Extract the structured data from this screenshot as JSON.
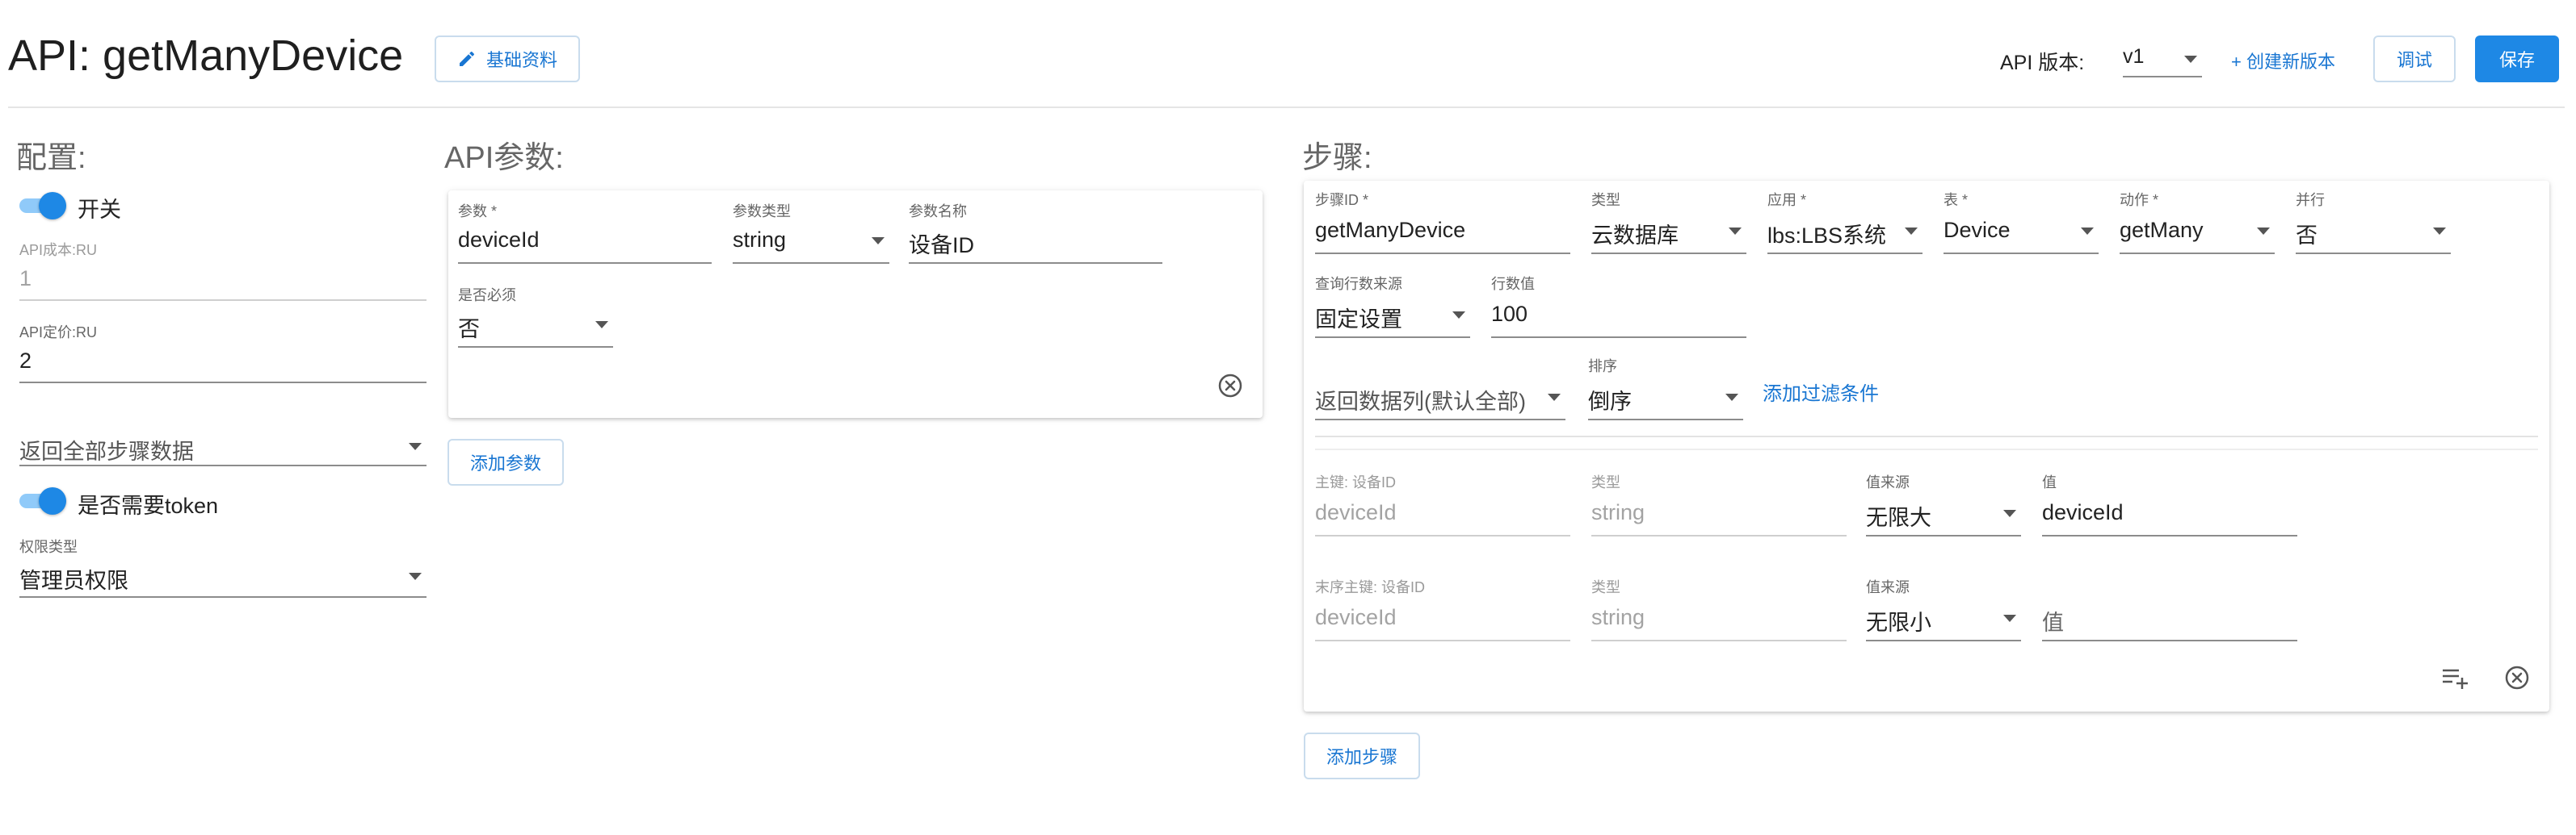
{
  "header": {
    "title": "API: getManyDevice",
    "basic_info_button": "基础资料",
    "version_label": "API 版本:",
    "version_value": "v1",
    "create_version_link": "+ 创建新版本",
    "debug_button": "调试",
    "save_button": "保存"
  },
  "config": {
    "title": "配置:",
    "switch_label": "开关",
    "switch_on": true,
    "cost_label": "API成本:RU",
    "cost_value": "1",
    "price_label": "API定价:RU",
    "price_value": "2",
    "return_select": "返回全部步骤数据",
    "token_label": "是否需要token",
    "token_on": true,
    "permission_label": "权限类型",
    "permission_value": "管理员权限"
  },
  "params": {
    "title": "API参数:",
    "items": [
      {
        "name_label": "参数 *",
        "name_value": "deviceId",
        "type_label": "参数类型",
        "type_value": "string",
        "display_label": "参数名称",
        "display_value": "设备ID",
        "required_label": "是否必须",
        "required_value": "否"
      }
    ],
    "add_button": "添加参数"
  },
  "steps": {
    "title": "步骤:",
    "items": [
      {
        "id_label": "步骤ID *",
        "id_value": "getManyDevice",
        "type_label": "类型",
        "type_value": "云数据库",
        "app_label": "应用 *",
        "app_value": "lbs:LBS系统",
        "table_label": "表 *",
        "table_value": "Device",
        "action_label": "动作 *",
        "action_value": "getMany",
        "parallel_label": "并行",
        "parallel_value": "否",
        "row_source_label": "查询行数来源",
        "row_source_value": "固定设置",
        "row_count_label": "行数值",
        "row_count_value": "100",
        "return_columns_value": "返回数据列(默认全部)",
        "sort_label": "排序",
        "sort_value": "倒序",
        "add_filter_link": "添加过滤条件",
        "keys": [
          {
            "key_label": "主键: 设备ID",
            "key_value": "deviceId",
            "type_label": "类型",
            "type_value": "string",
            "source_label": "值来源",
            "source_value": "无限大",
            "value_label": "值",
            "value_value": "deviceId",
            "value_is_placeholder": false
          },
          {
            "key_label": "末序主键: 设备ID",
            "key_value": "deviceId",
            "type_label": "类型",
            "type_value": "string",
            "source_label": "值来源",
            "source_value": "无限小",
            "value_label": "",
            "value_value": "值",
            "value_is_placeholder": true
          }
        ]
      }
    ],
    "add_button": "添加步骤"
  },
  "colors": {
    "primary": "#1e88e5",
    "toggle_track": "#90caf9",
    "link": "#1976d2"
  },
  "icons": [
    "pencil-icon",
    "dropdown-caret-icon",
    "close-circle-icon",
    "playlist-add-icon"
  ]
}
